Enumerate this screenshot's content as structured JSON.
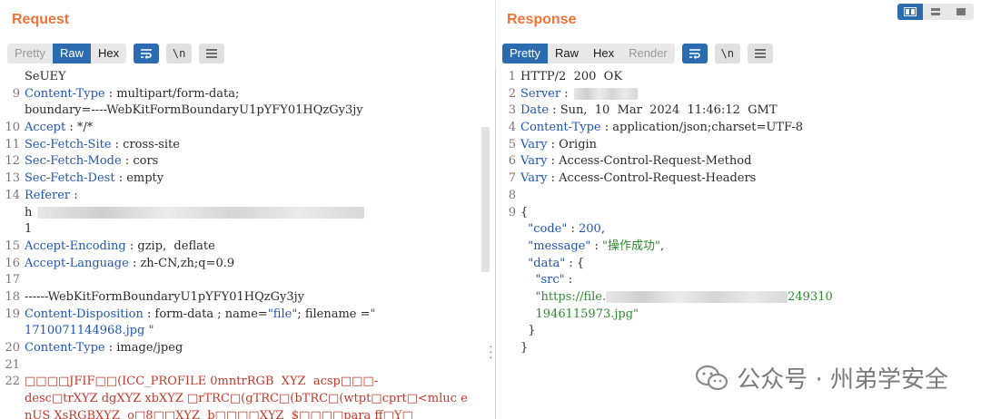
{
  "request": {
    "title": "Request",
    "tabs": [
      "Pretty",
      "Raw",
      "Hex"
    ],
    "lines": [
      {
        "n": "",
        "text": "SeUEY"
      },
      {
        "n": "9",
        "key": "Content-Type",
        "val": " : multipart/form-data;"
      },
      {
        "n": "",
        "text": "boundary=----WebKitFormBoundaryU1pYFY01HQzGy3jy"
      },
      {
        "n": "10",
        "key": "Accept",
        "val": " : */*"
      },
      {
        "n": "11",
        "key": "Sec-Fetch-Site",
        "val": " : cross-site"
      },
      {
        "n": "12",
        "key": "Sec-Fetch-Mode",
        "val": " : cors"
      },
      {
        "n": "13",
        "key": "Sec-Fetch-Dest",
        "val": " : empty"
      },
      {
        "n": "14",
        "key": "Referer",
        "val": " :"
      },
      {
        "n": "",
        "text": "h",
        "blur": 360
      },
      {
        "n": "",
        "text": "1"
      },
      {
        "n": "15",
        "key": "Accept-Encoding",
        "val": " : gzip,  deflate"
      },
      {
        "n": "16",
        "key": "Accept-Language",
        "val": " : zh-CN,zh;q=0.9"
      },
      {
        "n": "17",
        "text": ""
      },
      {
        "n": "18",
        "text": "------WebKitFormBoundaryU1pYFY01HQzGy3jy"
      },
      {
        "n": "19",
        "key": "Content-Disposition",
        "val": " : form-data ; name=",
        "extra": [
          {
            "c": "s",
            "t": "\"file\""
          },
          {
            "c": "txt",
            "t": "; filename ="
          },
          {
            "c": "s",
            "t": "\""
          }
        ]
      },
      {
        "n": "",
        "seg": [
          {
            "c": "s",
            "t": "1710071144968.jpg "
          },
          {
            "c": "s",
            "t": "\""
          }
        ]
      },
      {
        "n": "20",
        "key": "Content-Type",
        "val": " : image/jpeg"
      },
      {
        "n": "21",
        "text": ""
      },
      {
        "n": "22",
        "bin": "□□□□JFIF□□(ICC_PROFILE 0mntrRGB  XYZ  acsp□□□-"
      },
      {
        "n": "",
        "bin": "desc□trXYZ dgXYZ xbXYZ □rTRC□(gTRC□(bTRC□(wtpt□cprt□<mluc e"
      },
      {
        "n": "",
        "bin": "nUS XsRGBXYZ  o□8□□XYZ  b□□□□XYZ  $□□□□para ff□Y□"
      }
    ]
  },
  "response": {
    "title": "Response",
    "tabs": [
      "Pretty",
      "Raw",
      "Hex",
      "Render"
    ],
    "lines": [
      {
        "n": "1",
        "text": "HTTP/2  200  OK"
      },
      {
        "n": "2",
        "key": "Server",
        "val": " :",
        "blur": 70
      },
      {
        "n": "3",
        "key": "Date",
        "val": " : Sun,  10  Mar  2024  11:46:12  GMT"
      },
      {
        "n": "4",
        "key": "Content-Type",
        "val": " : application/json;charset=UTF-8"
      },
      {
        "n": "5",
        "key": "Vary",
        "val": " : Origin"
      },
      {
        "n": "6",
        "key": "Vary",
        "val": " : Access-Control-Request-Method"
      },
      {
        "n": "7",
        "key": "Vary",
        "val": " : Access-Control-Request-Headers"
      },
      {
        "n": "8",
        "text": ""
      },
      {
        "n": "9",
        "text": "{"
      },
      {
        "n": "",
        "seg": [
          {
            "c": "txt",
            "t": "  "
          },
          {
            "c": "k",
            "t": "\"code\""
          },
          {
            "c": "txt",
            "t": " : "
          },
          {
            "c": "k",
            "t": "200"
          },
          {
            "c": "txt",
            "t": ","
          }
        ]
      },
      {
        "n": "",
        "seg": [
          {
            "c": "txt",
            "t": "  "
          },
          {
            "c": "k",
            "t": "\"message\""
          },
          {
            "c": "txt",
            "t": " : "
          },
          {
            "c": "str",
            "t": "\"操作成功\""
          },
          {
            "c": "txt",
            "t": ","
          }
        ]
      },
      {
        "n": "",
        "seg": [
          {
            "c": "txt",
            "t": "  "
          },
          {
            "c": "k",
            "t": "\"data\""
          },
          {
            "c": "txt",
            "t": " : {"
          }
        ]
      },
      {
        "n": "",
        "seg": [
          {
            "c": "txt",
            "t": "    "
          },
          {
            "c": "k",
            "t": "\"src\""
          },
          {
            "c": "txt",
            "t": " :"
          }
        ]
      },
      {
        "n": "",
        "seg": [
          {
            "c": "txt",
            "t": "    "
          },
          {
            "c": "str",
            "t": "\"https://file."
          }
        ],
        "blurseg": 200,
        "tail": "249310"
      },
      {
        "n": "",
        "seg": [
          {
            "c": "txt",
            "t": "    "
          },
          {
            "c": "str",
            "t": "1946115973.jpg\""
          }
        ]
      },
      {
        "n": "",
        "text": "  }"
      },
      {
        "n": "",
        "text": "}"
      }
    ]
  },
  "watermark": {
    "text": "公众号 · 州弟学安全",
    "icon": "wechat-icon"
  },
  "colors": {
    "title": "#f0743a",
    "tab_active": "#2b6cb0",
    "header_key": "#1f56b6",
    "string": "#2e8a2e",
    "binary": "#c0392b"
  }
}
